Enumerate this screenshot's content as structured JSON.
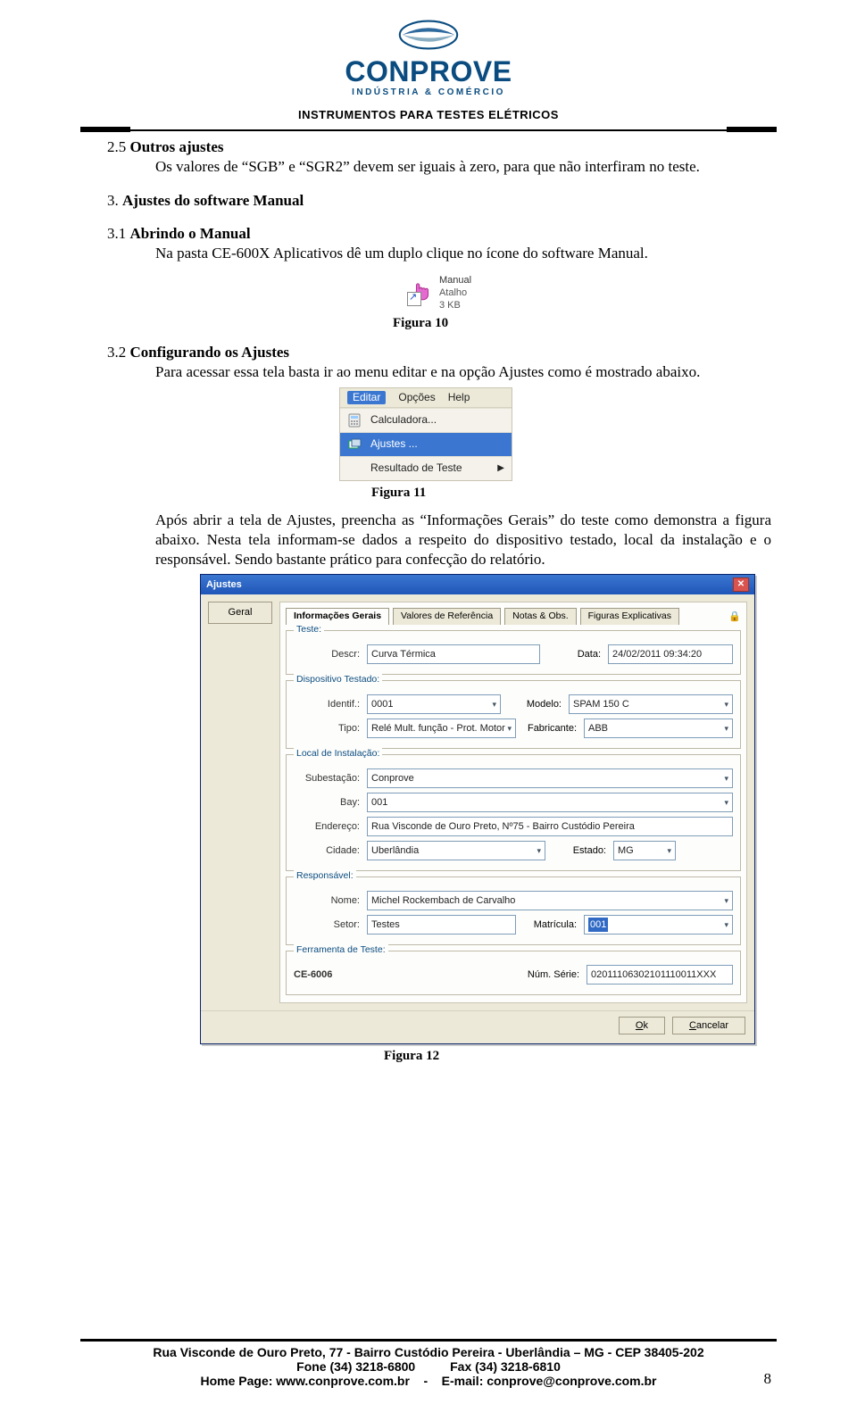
{
  "header": {
    "brand": "CONPROVE",
    "sub": "INDÚSTRIA & COMÉRCIO",
    "tagline": "INSTRUMENTOS PARA TESTES ELÉTRICOS"
  },
  "sec25": {
    "num": "2.5 ",
    "title": "Outros ajustes",
    "body": "Os valores de “SGB” e “SGR2” devem ser iguais à zero, para que não interfiram no teste."
  },
  "sec3": {
    "num": "3. ",
    "title": "Ajustes do software Manual"
  },
  "sec31": {
    "num": "3.1 ",
    "title": "Abrindo o Manual",
    "body": "Na pasta CE-600X Aplicativos dê um duplo clique no ícone do software Manual."
  },
  "shortcut": {
    "name": "Manual",
    "type": "Atalho",
    "size": "3 KB"
  },
  "fig10": "Figura 10",
  "sec32": {
    "num": "3.2 ",
    "title": "Configurando os Ajustes",
    "body": "Para acessar essa tela basta ir ao menu editar e na opção Ajustes como é mostrado abaixo."
  },
  "menu": {
    "bar": [
      "Editar",
      "Opções",
      "Help"
    ],
    "items": [
      {
        "label": "Calculadora...",
        "sel": false,
        "arrow": false
      },
      {
        "label": "Ajustes ...",
        "sel": true,
        "arrow": false
      },
      {
        "label": "Resultado de Teste",
        "sel": false,
        "arrow": true
      }
    ]
  },
  "fig11": "Figura 11",
  "para32after": "Após abrir a tela de Ajustes, preencha as “Informações Gerais” do teste como demonstra a figura abaixo. Nesta tela informam-se dados a respeito do dispositivo testado, local da instalação e o responsável. Sendo bastante prático para confecção do relatório.",
  "dlg": {
    "title": "Ajustes",
    "side": "Geral",
    "tabs": [
      "Informações Gerais",
      "Valores de Referência",
      "Notas & Obs.",
      "Figuras Explicativas"
    ],
    "grp_teste": {
      "legend": "Teste:",
      "descr_label": "Descr:",
      "descr_value": "Curva Térmica",
      "data_label": "Data:",
      "data_value": "24/02/2011 09:34:20"
    },
    "grp_disp": {
      "legend": "Dispositivo Testado:",
      "identif_label": "Identif.:",
      "identif_value": "0001",
      "modelo_label": "Modelo:",
      "modelo_value": "SPAM 150 C",
      "tipo_label": "Tipo:",
      "tipo_value": "Relé Mult. função - Prot. Motor",
      "fabr_label": "Fabricante:",
      "fabr_value": "ABB"
    },
    "grp_local": {
      "legend": "Local de Instalação:",
      "sub_label": "Subestação:",
      "sub_value": "Conprove",
      "bay_label": "Bay:",
      "bay_value": "001",
      "end_label": "Endereço:",
      "end_value": "Rua Visconde de Ouro Preto, Nº75 - Bairro Custódio Pereira",
      "cid_label": "Cidade:",
      "cid_value": "Uberlândia",
      "est_label": "Estado:",
      "est_value": "MG"
    },
    "grp_resp": {
      "legend": "Responsável:",
      "nome_label": "Nome:",
      "nome_value": "Michel Rockembach de Carvalho",
      "setor_label": "Setor:",
      "setor_value": "Testes",
      "mat_label": "Matrícula:",
      "mat_value": "001"
    },
    "grp_ferr": {
      "legend": "Ferramenta de Teste:",
      "model_label": "CE-6006",
      "serie_label": "Núm. Série:",
      "serie_value": "02011106302101110011XXX"
    },
    "ok": "Ok",
    "cancel": "Cancelar"
  },
  "fig12": "Figura 12",
  "footer": {
    "l1": "Rua Visconde de Ouro Preto, 77 -  Bairro Custódio Pereira - Uberlândia – MG -  CEP 38405-202",
    "l2": "Fone (34) 3218-6800          Fax (34) 3218-6810",
    "l3": "Home Page: www.conprove.com.br    -    E-mail: conprove@conprove.com.br"
  },
  "page_number": "8"
}
